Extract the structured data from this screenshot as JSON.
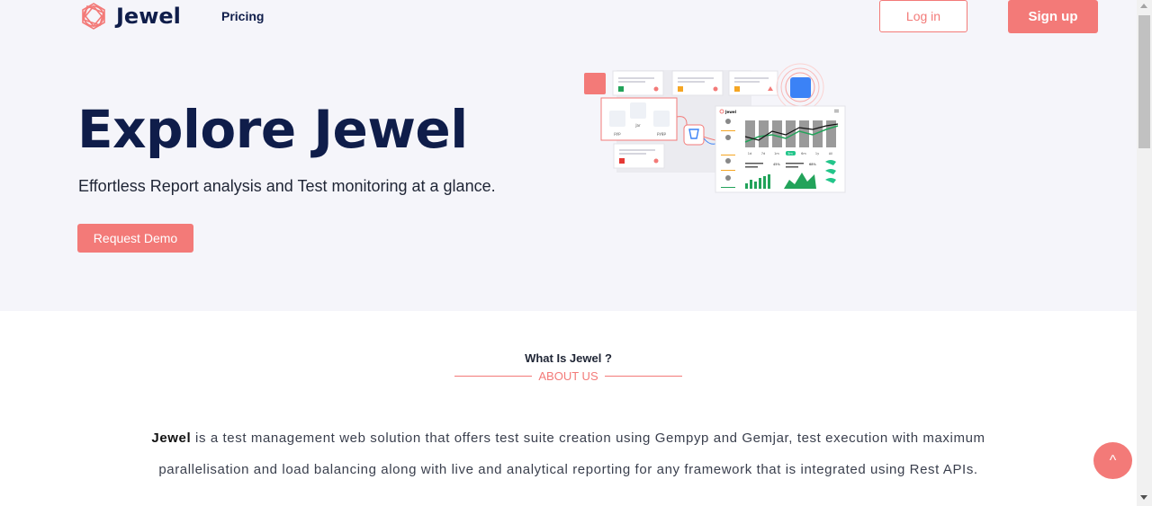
{
  "nav": {
    "brand": "Jewel",
    "pricing": "Pricing",
    "login": "Log in",
    "signup": "Sign up"
  },
  "hero": {
    "title": "Explore Jewel",
    "subtitle": "Effortless Report analysis and Test monitoring at a glance.",
    "demo_button": "Request Demo",
    "illustration": {
      "pyp_label": "pyp",
      "jar_label": "Jar",
      "gpyp_label": "pygp",
      "app_label": "Jewel",
      "days": [
        "1d",
        "7d",
        "1m",
        "3m",
        "6m",
        "1y",
        "All"
      ],
      "stat_1": "45%",
      "stat_2": "68%"
    }
  },
  "about": {
    "heading": "What Is Jewel ?",
    "subheading": "ABOUT US",
    "brand_word": "Jewel",
    "body": " is a test management web solution that offers test suite creation using Gempyp and Gemjar, test execution with maximum parallelisation and load balancing along with live and analytical reporting for any framework that is integrated using Rest APIs."
  },
  "scroll_top": "^",
  "colors": {
    "accent": "#f37a78",
    "navy": "#0f1d4a",
    "hero_bg": "#f5f5fa"
  }
}
